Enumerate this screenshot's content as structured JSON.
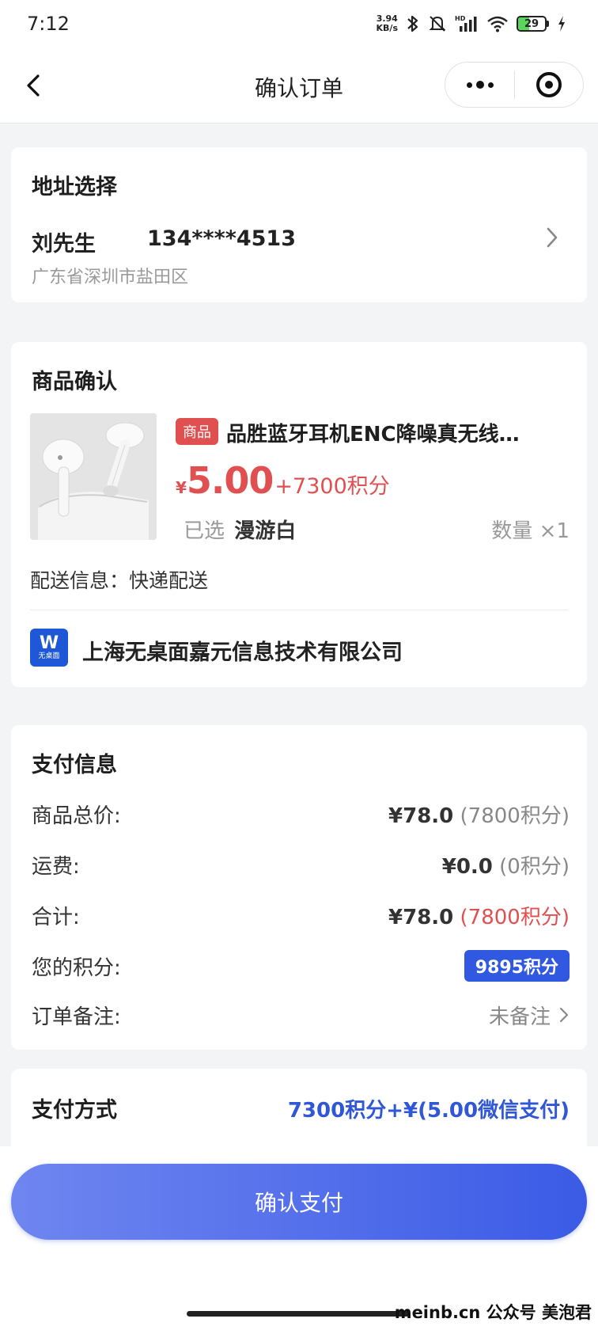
{
  "status_bar": {
    "time": "7:12",
    "net_speed_top": "3.94",
    "net_speed_bottom": "KB/s",
    "battery": "29"
  },
  "nav": {
    "title": "确认订单"
  },
  "address": {
    "title": "地址选择",
    "name": "刘先生",
    "phone": "134****4513",
    "location": "广东省深圳市盐田区"
  },
  "product": {
    "title": "商品确认",
    "tag": "商品",
    "name": "品胜蓝牙耳机ENC降噪真无线…",
    "price_symbol": "¥",
    "price_amount": "5.00",
    "price_points": "+7300积分",
    "selected_label": "已选",
    "selected_value": "漫游白",
    "quantity": "数量 ×1",
    "shipping": "配送信息：快递配送",
    "shop_logo_text": "无桌面",
    "shop_name": "上海无桌面嘉元信息技术有限公司"
  },
  "payment_info": {
    "title": "支付信息",
    "rows": [
      {
        "label": "商品总价:",
        "value": "¥78.0",
        "extra": " (7800积分)"
      },
      {
        "label": "运费:",
        "value": "¥0.0",
        "extra": " (0积分)"
      },
      {
        "label": "合计:",
        "value": "¥78.0",
        "extra": " (7800积分)"
      }
    ],
    "points_label": "您的积分:",
    "points_value": "9895积分",
    "note_label": "订单备注:",
    "note_value": "未备注"
  },
  "payment_method": {
    "title": "支付方式",
    "value": "7300积分+¥(5.00微信支付)"
  },
  "confirm_button": "确认支付",
  "watermark": "meinb.cn  公众号 美泡君",
  "colors": {
    "accent_red": "#e15050",
    "accent_blue": "#3058e0",
    "button_gradient_start": "#6f86f0",
    "button_gradient_end": "#3b5be6"
  }
}
